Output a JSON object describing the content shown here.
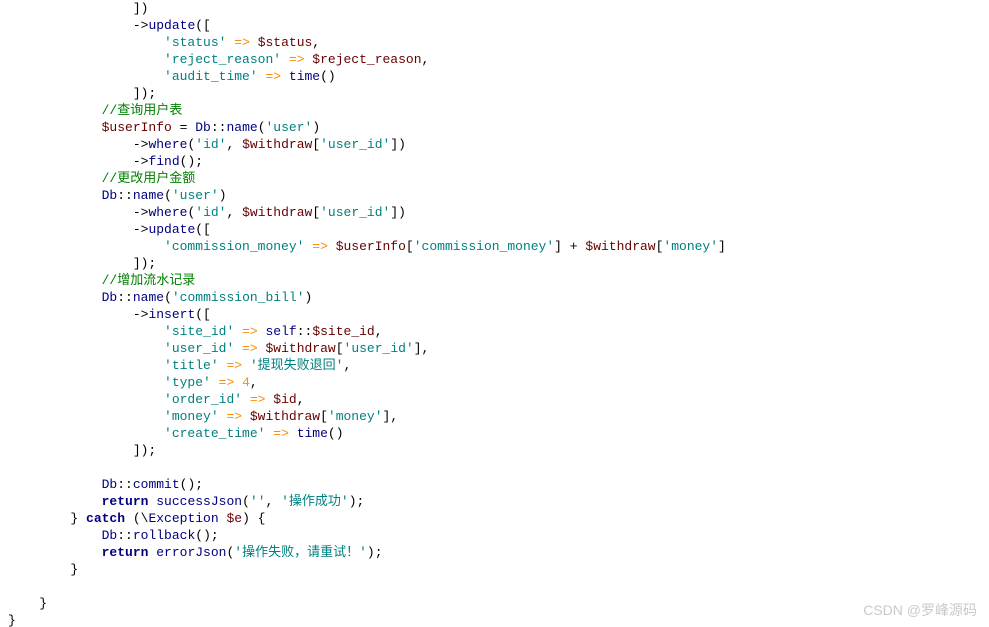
{
  "code": {
    "l01": {
      "mth": "update"
    },
    "l02": {
      "key": "'status'",
      "arrow": "=>",
      "val": "$status"
    },
    "l03": {
      "key": "'reject_reason'",
      "arrow": "=>",
      "val": "$reject_reason"
    },
    "l04": {
      "key": "'audit_time'",
      "arrow": "=>",
      "fn": "time"
    },
    "l06_cmt": "//查询用户表",
    "l07": {
      "var": "$userInfo",
      "cls": "Db",
      "mth": "name",
      "arg": "'user'"
    },
    "l08": {
      "mth": "where",
      "arg1": "'id'",
      "var": "$withdraw",
      "idx": "'user_id'"
    },
    "l09": {
      "mth": "find"
    },
    "l10_cmt": "//更改用户金额",
    "l11": {
      "cls": "Db",
      "mth": "name",
      "arg": "'user'"
    },
    "l12": {
      "mth": "where",
      "arg1": "'id'",
      "var": "$withdraw",
      "idx": "'user_id'"
    },
    "l13": {
      "mth": "update"
    },
    "l14": {
      "key": "'commission_money'",
      "arrow": "=>",
      "var1": "$userInfo",
      "idx1": "'commission_money'",
      "var2": "$withdraw",
      "idx2": "'money'"
    },
    "l16_cmt": "//增加流水记录",
    "l17": {
      "cls": "Db",
      "mth": "name",
      "arg": "'commission_bill'"
    },
    "l18": {
      "mth": "insert"
    },
    "l19": {
      "key": "'site_id'",
      "arrow": "=>",
      "self": "self",
      "prop": "$site_id"
    },
    "l20": {
      "key": "'user_id'",
      "arrow": "=>",
      "var": "$withdraw",
      "idx": "'user_id'"
    },
    "l21": {
      "key": "'title'",
      "arrow": "=>",
      "val": "'提现失败退回'"
    },
    "l22": {
      "key": "'type'",
      "arrow": "=>",
      "val": "4"
    },
    "l23": {
      "key": "'order_id'",
      "arrow": "=>",
      "val": "$id"
    },
    "l24": {
      "key": "'money'",
      "arrow": "=>",
      "var": "$withdraw",
      "idx": "'money'"
    },
    "l25": {
      "key": "'create_time'",
      "arrow": "=>",
      "fn": "time"
    },
    "l28": {
      "cls": "Db",
      "mth": "commit"
    },
    "l29": {
      "kw": "return",
      "fn": "successJson",
      "arg1": "''",
      "arg2": "'操作成功'"
    },
    "l30": {
      "kw": "catch",
      "exc": "Exception",
      "var": "$e"
    },
    "l31": {
      "cls": "Db",
      "mth": "rollback"
    },
    "l32": {
      "kw": "return",
      "fn": "errorJson",
      "arg": "'操作失败，请重试！'"
    }
  },
  "watermark": "CSDN @罗峰源码"
}
